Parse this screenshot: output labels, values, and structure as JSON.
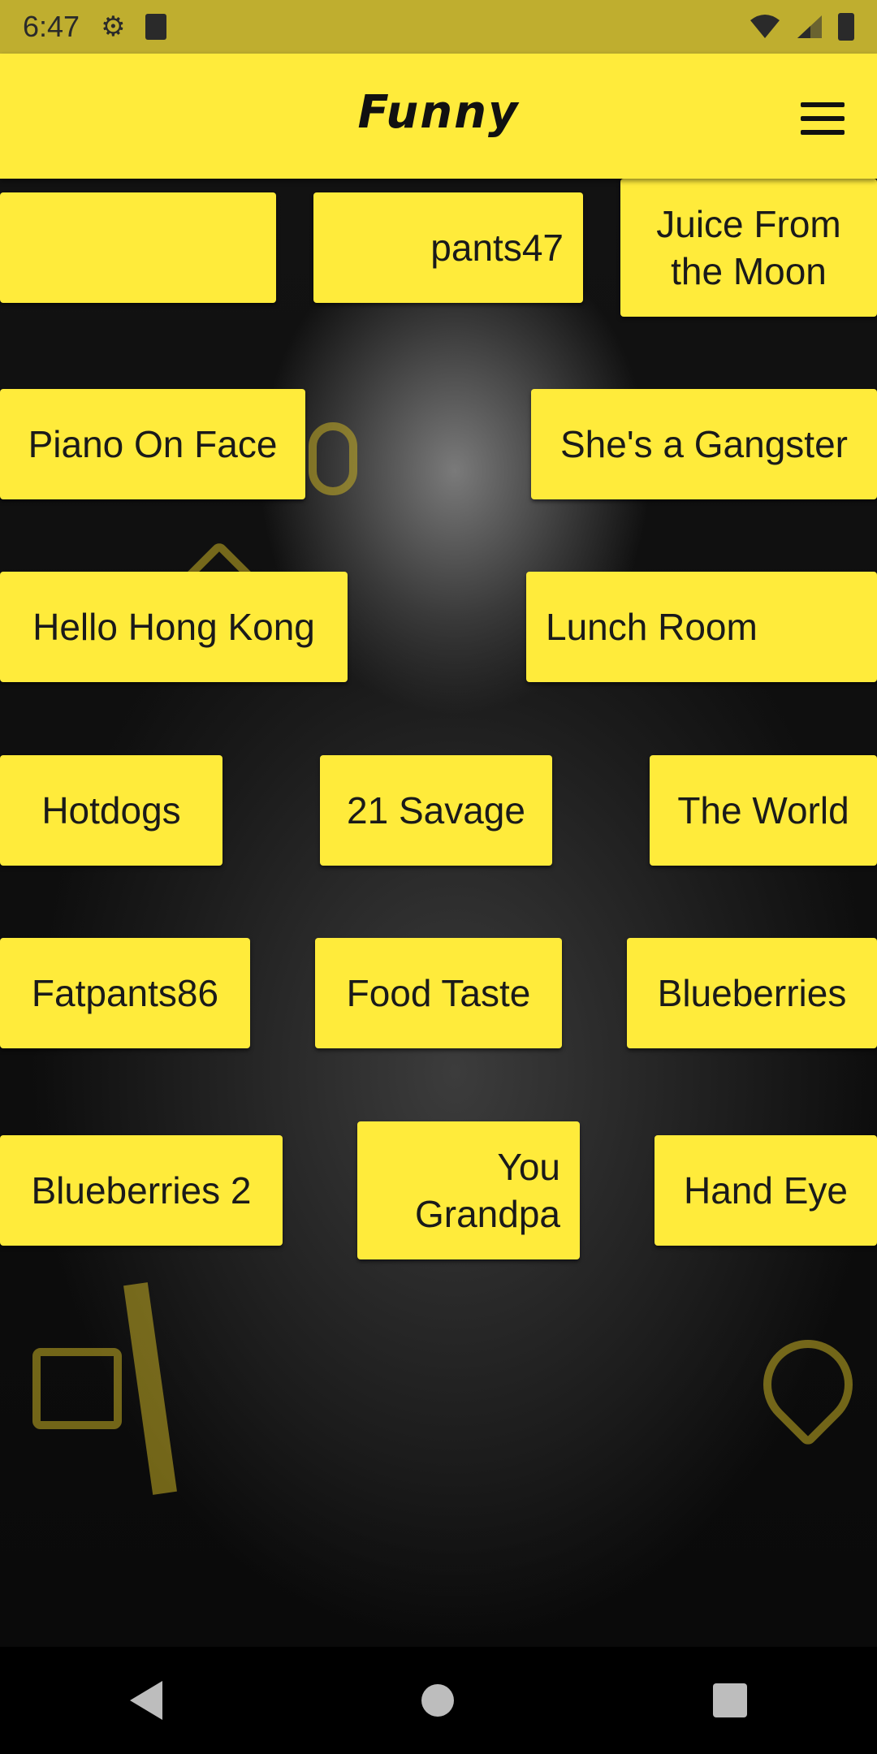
{
  "status_bar": {
    "time": "6:47",
    "icons": [
      "gear-icon",
      "sd-card-icon",
      "wifi-icon",
      "signal-icon",
      "battery-icon"
    ]
  },
  "app_bar": {
    "title": "Funny",
    "menu_icon": "hamburger-menu-icon"
  },
  "buttons": [
    {
      "label": ""
    },
    {
      "label": "pants47"
    },
    {
      "label": "Juice From the Moon"
    },
    {
      "label": "Piano On Face"
    },
    {
      "label": "She's a Gangster"
    },
    {
      "label": "Hello Hong Kong"
    },
    {
      "label": "Lunch Room"
    },
    {
      "label": "Hotdogs"
    },
    {
      "label": "21 Savage"
    },
    {
      "label": "The World"
    },
    {
      "label": "Fatpants86"
    },
    {
      "label": "Food Taste"
    },
    {
      "label": "Blueberries"
    },
    {
      "label": "Blueberries 2"
    },
    {
      "label": "You Grandpa"
    },
    {
      "label": "Hand Eye"
    }
  ],
  "colors": {
    "accent": "#FFEB3B",
    "status_bar": "#BFAE2F",
    "background": "#000000"
  },
  "nav_bar": {
    "icons": [
      "back-icon",
      "home-icon",
      "recent-apps-icon"
    ]
  }
}
